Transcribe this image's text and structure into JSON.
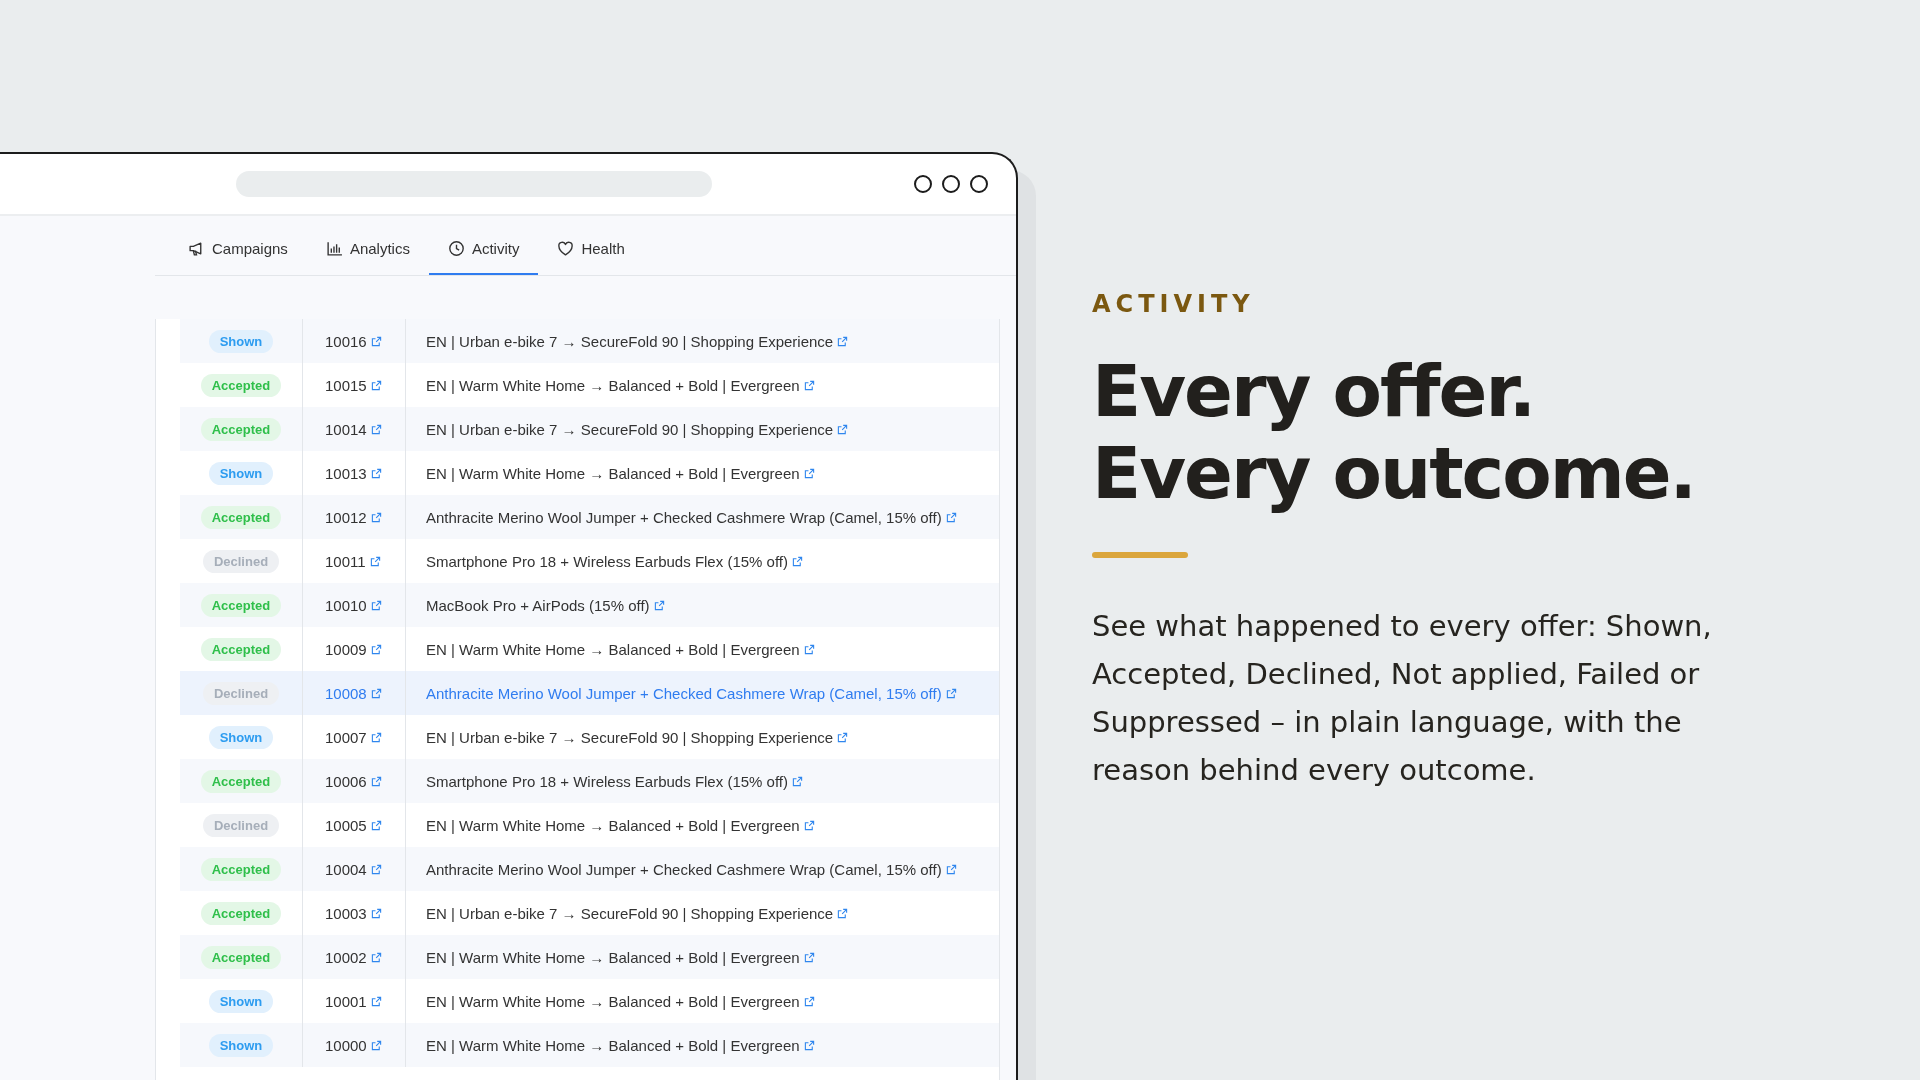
{
  "tabs": [
    {
      "label": "Campaigns",
      "selected": false
    },
    {
      "label": "Analytics",
      "selected": false
    },
    {
      "label": "Activity",
      "selected": true
    },
    {
      "label": "Health",
      "selected": false
    }
  ],
  "rows": [
    {
      "status": "Shown",
      "kind": "shown",
      "id": "10016",
      "offer": "EN | Urban e-bike 7 → SecureFold 90 | Shopping Experience",
      "selected": false
    },
    {
      "status": "Accepted",
      "kind": "accepted",
      "id": "10015",
      "offer": "EN | Warm White Home → Balanced + Bold | Evergreen",
      "selected": false
    },
    {
      "status": "Accepted",
      "kind": "accepted",
      "id": "10014",
      "offer": "EN | Urban e-bike 7 → SecureFold 90 | Shopping Experience",
      "selected": false
    },
    {
      "status": "Shown",
      "kind": "shown",
      "id": "10013",
      "offer": "EN | Warm White Home → Balanced + Bold | Evergreen",
      "selected": false
    },
    {
      "status": "Accepted",
      "kind": "accepted",
      "id": "10012",
      "offer": "Anthracite Merino Wool Jumper + Checked Cashmere Wrap (Camel, 15% off)",
      "selected": false
    },
    {
      "status": "Declined",
      "kind": "declined",
      "id": "10011",
      "offer": "Smartphone Pro 18 + Wireless Earbuds Flex (15% off)",
      "selected": false
    },
    {
      "status": "Accepted",
      "kind": "accepted",
      "id": "10010",
      "offer": "MacBook Pro + AirPods (15% off)",
      "selected": false
    },
    {
      "status": "Accepted",
      "kind": "accepted",
      "id": "10009",
      "offer": "EN | Warm White Home → Balanced + Bold | Evergreen",
      "selected": false
    },
    {
      "status": "Declined",
      "kind": "declined",
      "id": "10008",
      "offer": "Anthracite Merino Wool Jumper + Checked Cashmere Wrap (Camel, 15% off)",
      "selected": true
    },
    {
      "status": "Shown",
      "kind": "shown",
      "id": "10007",
      "offer": "EN | Urban e-bike 7 → SecureFold 90 | Shopping Experience",
      "selected": false
    },
    {
      "status": "Accepted",
      "kind": "accepted",
      "id": "10006",
      "offer": "Smartphone Pro 18 + Wireless Earbuds Flex (15% off)",
      "selected": false
    },
    {
      "status": "Declined",
      "kind": "declined",
      "id": "10005",
      "offer": "EN | Warm White Home → Balanced + Bold | Evergreen",
      "selected": false
    },
    {
      "status": "Accepted",
      "kind": "accepted",
      "id": "10004",
      "offer": "Anthracite Merino Wool Jumper + Checked Cashmere Wrap (Camel, 15% off)",
      "selected": false
    },
    {
      "status": "Accepted",
      "kind": "accepted",
      "id": "10003",
      "offer": "EN | Urban e-bike 7 → SecureFold 90 | Shopping Experience",
      "selected": false
    },
    {
      "status": "Accepted",
      "kind": "accepted",
      "id": "10002",
      "offer": "EN | Warm White Home → Balanced + Bold | Evergreen",
      "selected": false
    },
    {
      "status": "Shown",
      "kind": "shown",
      "id": "10001",
      "offer": "EN | Warm White Home → Balanced + Bold | Evergreen",
      "selected": false
    },
    {
      "status": "Shown",
      "kind": "shown",
      "id": "10000",
      "offer": "EN | Warm White Home → Balanced + Bold | Evergreen",
      "selected": false
    }
  ],
  "eyebrow": "ACTIVITY",
  "headline": [
    "Every offer.",
    "Every outcome."
  ],
  "description": "See what happened to every offer: Shown, Accepted, Declined, Not applied, Failed or Suppressed – in plain language, with the reason behind every outcome."
}
